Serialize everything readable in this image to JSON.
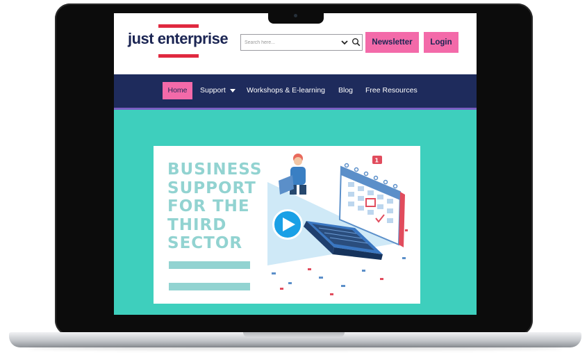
{
  "site": {
    "logo_text": "just enterprise",
    "brand_colors": {
      "navy": "#1b2553",
      "pink": "#f36aa9",
      "red": "#e0293f",
      "teal": "#3ecfbd",
      "nav_bg": "#1e2b5c"
    }
  },
  "header": {
    "search": {
      "placeholder": "Search here...",
      "dropdown_icon": "chevron-down-icon",
      "search_icon": "search-icon"
    },
    "newsletter_label": "Newsletter",
    "login_label": "Login"
  },
  "nav": {
    "items": [
      {
        "label": "Home",
        "active": true
      },
      {
        "label": "Support",
        "has_dropdown": true
      },
      {
        "label": "Workshops & E-learning"
      },
      {
        "label": "Blog"
      },
      {
        "label": "Free Resources"
      }
    ]
  },
  "hero": {
    "title": "BUSINESS\nSUPPORT\nFOR THE\nTHIRD\nSECTOR",
    "play_icon": "play-icon"
  }
}
